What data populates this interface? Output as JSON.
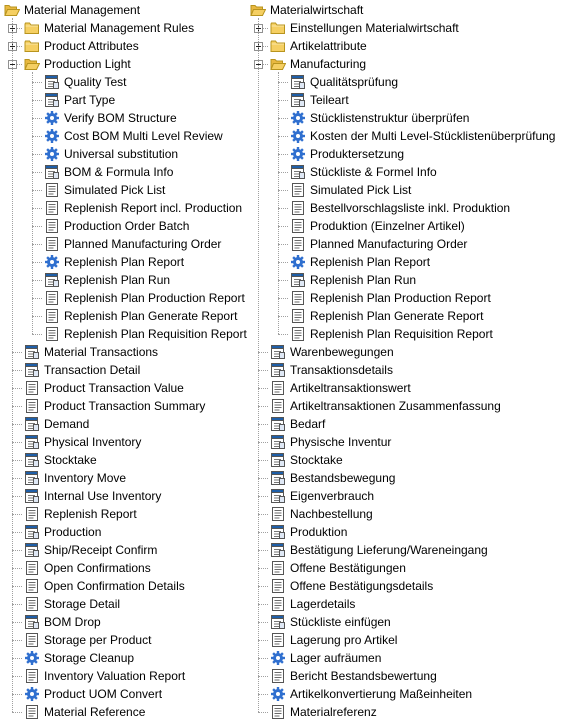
{
  "left_tree": {
    "root": {
      "label": "Material Management",
      "icon": "folder-open-icon",
      "expanded": true
    },
    "root_children": [
      {
        "label": "Material Management Rules",
        "icon": "folder-icon",
        "expander": "plus"
      },
      {
        "label": "Product Attributes",
        "icon": "folder-icon",
        "expander": "plus"
      },
      {
        "label": "Production Light",
        "icon": "folder-open-icon",
        "expander": "minus",
        "children": [
          {
            "label": "Quality Test",
            "icon": "window-icon"
          },
          {
            "label": "Part Type",
            "icon": "window-icon"
          },
          {
            "label": "Verify BOM Structure",
            "icon": "gear-icon"
          },
          {
            "label": "Cost BOM Multi Level Review",
            "icon": "gear-icon"
          },
          {
            "label": "Universal substitution",
            "icon": "gear-icon"
          },
          {
            "label": "BOM & Formula Info",
            "icon": "window-icon"
          },
          {
            "label": "Simulated Pick List",
            "icon": "report-icon"
          },
          {
            "label": "Replenish Report incl. Production",
            "icon": "report-icon"
          },
          {
            "label": "Production Order Batch",
            "icon": "report-icon"
          },
          {
            "label": "Planned Manufacturing Order",
            "icon": "report-icon"
          },
          {
            "label": "Replenish Plan Report",
            "icon": "gear-icon"
          },
          {
            "label": "Replenish Plan Run",
            "icon": "window-icon"
          },
          {
            "label": "Replenish Plan Production Report",
            "icon": "report-icon"
          },
          {
            "label": "Replenish Plan Generate Report",
            "icon": "report-icon"
          },
          {
            "label": "Replenish Plan Requisition Report",
            "icon": "report-icon"
          }
        ]
      },
      {
        "label": "Material Transactions",
        "icon": "window-icon"
      },
      {
        "label": "Transaction Detail",
        "icon": "window-icon"
      },
      {
        "label": "Product Transaction Value",
        "icon": "report-icon"
      },
      {
        "label": "Product Transaction Summary",
        "icon": "report-icon"
      },
      {
        "label": "Demand",
        "icon": "window-icon"
      },
      {
        "label": "Physical Inventory",
        "icon": "window-icon"
      },
      {
        "label": "Stocktake",
        "icon": "window-icon"
      },
      {
        "label": "Inventory Move",
        "icon": "window-icon"
      },
      {
        "label": "Internal Use Inventory",
        "icon": "window-icon"
      },
      {
        "label": "Replenish Report",
        "icon": "report-icon"
      },
      {
        "label": "Production",
        "icon": "window-icon"
      },
      {
        "label": "Ship/Receipt Confirm",
        "icon": "window-icon"
      },
      {
        "label": "Open Confirmations",
        "icon": "report-icon"
      },
      {
        "label": "Open Confirmation Details",
        "icon": "report-icon"
      },
      {
        "label": "Storage Detail",
        "icon": "report-icon"
      },
      {
        "label": "BOM Drop",
        "icon": "window-icon"
      },
      {
        "label": "Storage per Product",
        "icon": "report-icon"
      },
      {
        "label": "Storage Cleanup",
        "icon": "gear-icon"
      },
      {
        "label": "Inventory Valuation Report",
        "icon": "report-icon"
      },
      {
        "label": "Product UOM Convert",
        "icon": "gear-icon"
      },
      {
        "label": "Material Reference",
        "icon": "report-icon"
      }
    ]
  },
  "right_tree": {
    "root": {
      "label": "Materialwirtschaft",
      "icon": "folder-open-icon",
      "expanded": true
    },
    "root_children": [
      {
        "label": "Einstellungen Materialwirtschaft",
        "icon": "folder-icon",
        "expander": "plus"
      },
      {
        "label": "Artikelattribute",
        "icon": "folder-icon",
        "expander": "plus"
      },
      {
        "label": "Manufacturing",
        "icon": "folder-open-icon",
        "expander": "minus",
        "children": [
          {
            "label": "Qualitätsprüfung",
            "icon": "window-icon"
          },
          {
            "label": "Teileart",
            "icon": "window-icon"
          },
          {
            "label": "Stücklistenstruktur überprüfen",
            "icon": "gear-icon"
          },
          {
            "label": "Kosten der Multi Level-Stücklistenüberprüfung",
            "icon": "gear-icon"
          },
          {
            "label": "Produktersetzung",
            "icon": "gear-icon"
          },
          {
            "label": " Stückliste & Formel Info",
            "icon": "window-icon"
          },
          {
            "label": "Simulated Pick List",
            "icon": "report-icon"
          },
          {
            "label": "Bestellvorschlagsliste inkl. Produktion",
            "icon": "report-icon"
          },
          {
            "label": "Produktion (Einzelner Artikel)",
            "icon": "report-icon"
          },
          {
            "label": "Planned Manufacturing Order",
            "icon": "report-icon"
          },
          {
            "label": "Replenish Plan Report",
            "icon": "gear-icon"
          },
          {
            "label": "Replenish Plan Run",
            "icon": "window-icon"
          },
          {
            "label": "Replenish Plan Production Report",
            "icon": "report-icon"
          },
          {
            "label": "Replenish Plan Generate Report",
            "icon": "report-icon"
          },
          {
            "label": "Replenish Plan Requisition Report",
            "icon": "report-icon"
          }
        ]
      },
      {
        "label": "Warenbewegungen",
        "icon": "window-icon"
      },
      {
        "label": "Transaktionsdetails",
        "icon": "window-icon"
      },
      {
        "label": "Artikeltransaktionswert",
        "icon": "report-icon"
      },
      {
        "label": "Artikeltransaktionen Zusammenfassung",
        "icon": "report-icon"
      },
      {
        "label": "Bedarf",
        "icon": "window-icon"
      },
      {
        "label": "Physische Inventur",
        "icon": "window-icon"
      },
      {
        "label": "Stocktake",
        "icon": "window-icon"
      },
      {
        "label": "Bestandsbewegung",
        "icon": "window-icon"
      },
      {
        "label": "Eigenverbrauch",
        "icon": "window-icon"
      },
      {
        "label": "Nachbestellung",
        "icon": "report-icon"
      },
      {
        "label": "Produktion",
        "icon": "window-icon"
      },
      {
        "label": "Bestätigung Lieferung/Wareneingang",
        "icon": "window-icon"
      },
      {
        "label": "Offene Bestätigungen",
        "icon": "report-icon"
      },
      {
        "label": "Offene Bestätigungsdetails",
        "icon": "report-icon"
      },
      {
        "label": "Lagerdetails",
        "icon": "report-icon"
      },
      {
        "label": "Stückliste einfügen",
        "icon": "window-icon"
      },
      {
        "label": "Lagerung pro Artikel",
        "icon": "report-icon"
      },
      {
        "label": "Lager aufräumen",
        "icon": "gear-icon"
      },
      {
        "label": "Bericht Bestandsbewertung",
        "icon": "report-icon"
      },
      {
        "label": "Artikelkonvertierung Maßeinheiten",
        "icon": "gear-icon"
      },
      {
        "label": "Materialreferenz",
        "icon": "report-icon"
      }
    ]
  },
  "colors": {
    "folder": "#f5cf62",
    "folder_border": "#b8941e",
    "window_title": "#1f5fa8",
    "gear": "#2f6fcf",
    "report_lines": "#6a6a6a",
    "tree_lines": "#a0a0a0",
    "expander_border": "#919191"
  }
}
